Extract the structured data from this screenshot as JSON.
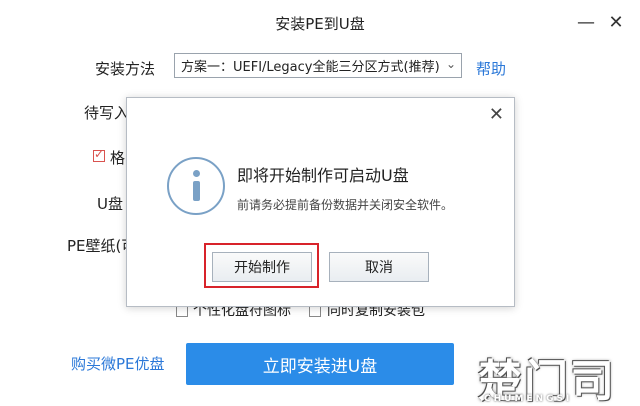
{
  "window": {
    "title": "安装PE到U盘",
    "minimize_glyph": "—",
    "close_glyph": "✕"
  },
  "form": {
    "install_method_label": "安装方法",
    "install_method_value": "方案一：UEFI/Legacy全能三分区方式(推荐)",
    "help_link": "帮助",
    "target_label_partial": "待写入",
    "format_label_partial": "格",
    "usb_label_partial": "U盘",
    "wallpaper_label_partial": "PE壁纸(可",
    "option1_label_partial": "个性化盘符图标",
    "option2_label_partial": "同时复制安装包"
  },
  "footer": {
    "buy_link": "购买微PE优盘",
    "install_button": "立即安装进U盘"
  },
  "dialog": {
    "heading": "即将开始制作可启动U盘",
    "message": "前请务必提前备份数据并关闭安全软件。",
    "start_button": "开始制作",
    "cancel_button": "取消",
    "close_glyph": "✕",
    "icon": "info-icon"
  },
  "watermark": {
    "text": "楚门司",
    "subtext": "CHUMENGSI"
  },
  "colors": {
    "accent": "#2b8ce8",
    "link": "#2b78d8",
    "highlight": "#d8232a"
  }
}
